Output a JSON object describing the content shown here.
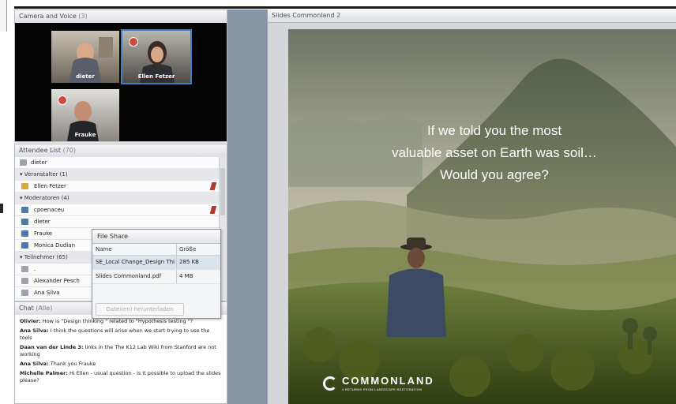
{
  "camera_pod": {
    "title": "Camera and Voice",
    "count": "(3)",
    "participants": [
      {
        "name": "dieter"
      },
      {
        "name": "Ellen Fetzer"
      },
      {
        "name": "Frauke"
      }
    ]
  },
  "attendee_pod": {
    "title": "Attendee List",
    "count": "(70)",
    "me": "dieter",
    "groups": [
      {
        "label": "Veranstalter (1)",
        "members": [
          "Ellen Fetzer"
        ]
      },
      {
        "label": "Moderatoren (4)",
        "members": [
          "cpoenaceu",
          "dieter",
          "Frauke",
          "Monica Dudian"
        ]
      },
      {
        "label": "Teilnehmer (65)",
        "members": [
          ".",
          "Alexander Pesch",
          "Ana Silva"
        ]
      }
    ]
  },
  "file_share": {
    "title": "File Share",
    "col_name": "Name",
    "col_size": "Größe",
    "files": [
      {
        "name": "SE_Local Change_Design Thi",
        "size": "285 KB"
      },
      {
        "name": "Slides Commonland.pdf",
        "size": "4 MB"
      }
    ],
    "download_button": "Datei(en) herunterladen"
  },
  "chat_pod": {
    "title": "Chat",
    "count": "(Alle)",
    "messages": [
      {
        "who": "Olivier:",
        "text": "How is \"Design thinking \" related  to \"Hypothesis testing \"?"
      },
      {
        "who": "Ana Silva:",
        "text": "I think the questions will arise when we start trying to use the tools"
      },
      {
        "who": "Daan van der Linde 3:",
        "text": "links in the The K12 Lab Wiki from Stanford are not working"
      },
      {
        "who": "Ana Silva:",
        "text": "Thank you Frauke"
      },
      {
        "who": "Michelle Palmer:",
        "text": "Hi Ellen - usual question - is it possible to upload the slides please?"
      }
    ]
  },
  "slides_pod": {
    "title": "Slides Commonland 2",
    "quote_lines": [
      "If we told you the most",
      "valuable asset on Earth was soil…",
      "Would you agree?"
    ],
    "brand": "COMMONLAND",
    "tagline": "4 RETURNS FROM LANDSCAPE RESTORATION"
  },
  "colors": {
    "pod_header": "#dcdee2",
    "stage_gap": "#8794a3",
    "accent_blue": "#3f7fbf",
    "status_red": "#b33a33"
  }
}
